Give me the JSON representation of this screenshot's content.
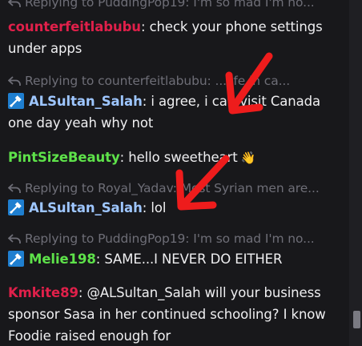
{
  "colors": {
    "background": "#18181b",
    "reply_text": "#6e6e77",
    "message_text": "#efeff1",
    "arrow": "#ee1c1c",
    "mod_badge": "#1f7fd0"
  },
  "messages": [
    {
      "reply_to": "Replying to PuddingPop19: I'm so mad I'm no..."
    },
    {
      "username": "counterfeitlabubu",
      "name_color": "#e0204a",
      "text": "check your phone settings under apps"
    },
    {
      "reply_to": "Replying to counterfeitlabubu: ...life in ca..."
    },
    {
      "username": "ALSultan_Salah",
      "name_color": "#9ec6ff",
      "badge": "moderator-sword-icon",
      "text": "i agree, i can visit Canada one day yeah why not"
    },
    {
      "username": "PintSizeBeauty",
      "name_color": "#5ee24a",
      "text": "hello sweetheart",
      "emoji": "👋"
    },
    {
      "reply_to": "Replying to Royal_Yadav: Most Syrian men are..."
    },
    {
      "username": "ALSultan_Salah",
      "name_color": "#9ec6ff",
      "badge": "moderator-sword-icon",
      "text": "lol"
    },
    {
      "reply_to": "Replying to PuddingPop19: I'm so mad I'm no..."
    },
    {
      "username": "Melie198",
      "name_color": "#5ee24a",
      "badge": "moderator-sword-icon",
      "text": "SAME...I NEVER DO EITHER"
    },
    {
      "username": "Kmkite89",
      "name_color": "#e0204a",
      "text": "@ALSultan_Salah will your business sponsor Sasa in her continued schooling? I know Foodie raised enough for"
    }
  ]
}
